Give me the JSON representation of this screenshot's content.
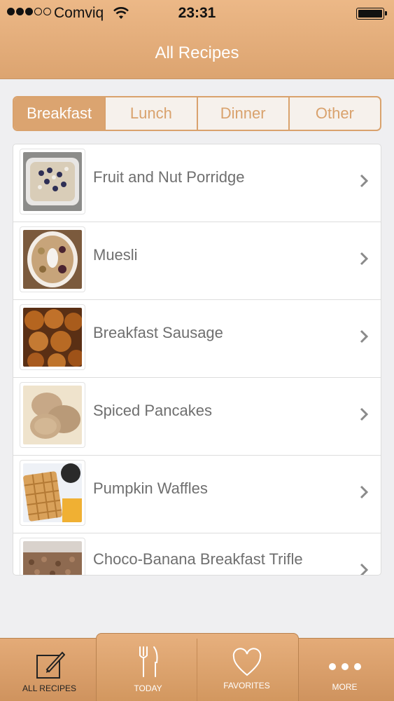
{
  "status_bar": {
    "carrier": "Comviq",
    "time": "23:31"
  },
  "nav": {
    "title": "All Recipes"
  },
  "segments": {
    "items": [
      "Breakfast",
      "Lunch",
      "Dinner",
      "Other"
    ],
    "selected": "Breakfast"
  },
  "recipes": [
    {
      "name": "Fruit and Nut Porridge"
    },
    {
      "name": "Muesli"
    },
    {
      "name": "Breakfast Sausage"
    },
    {
      "name": "Spiced Pancakes"
    },
    {
      "name": "Pumpkin Waffles"
    },
    {
      "name": "Choco-Banana Breakfast Trifle"
    }
  ],
  "tabbar": {
    "items": [
      "ALL RECIPES",
      "TODAY",
      "FAVORITES",
      "MORE"
    ],
    "selected": "ALL RECIPES"
  },
  "colors": {
    "accent": "#dba470",
    "nav_bar": "#e5ae7c",
    "label_text": "#6f6f6f"
  }
}
